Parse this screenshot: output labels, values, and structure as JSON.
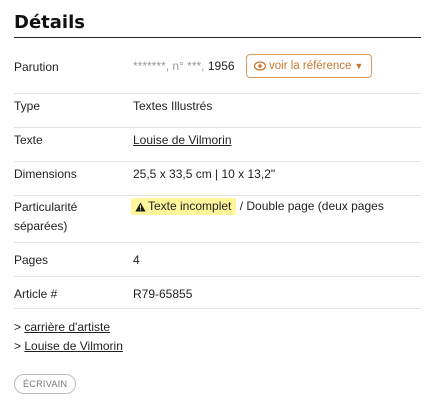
{
  "section_title": "Détails",
  "rows": {
    "parution": {
      "label": "Parution",
      "value_masked": "*******, n° ***,",
      "value_year": "1956",
      "ref_button": "voir la référence"
    },
    "type": {
      "label": "Type",
      "value": "Textes Illustrés"
    },
    "texte": {
      "label": "Texte",
      "value": "Louise de Vilmorin"
    },
    "dimensions": {
      "label": "Dimensions",
      "value": "25,5 x 33,5 cm | 10 x 13,2\""
    },
    "particularite": {
      "label_line1": "Particularité",
      "label_line2": "séparées)",
      "badge": "Texte incomplet",
      "rest": "/ Double page (deux pages"
    },
    "pages": {
      "label": "Pages",
      "value": "4"
    },
    "article": {
      "label": "Article #",
      "value": "R79-65855"
    }
  },
  "links": [
    {
      "prefix": ">",
      "label": "carrière d'artiste"
    },
    {
      "prefix": ">",
      "label": "Louise de Vilmorin"
    }
  ],
  "tag_chip": "ÉCRIVAIN",
  "icons": {
    "ref_button_icon": "eye-icon",
    "ref_button_caret": "caret-down-icon",
    "badge_icon": "warning-icon"
  },
  "colors": {
    "accent": "#c9772f",
    "badge_bg": "#fff59b",
    "divider": "#e3e3e3"
  }
}
